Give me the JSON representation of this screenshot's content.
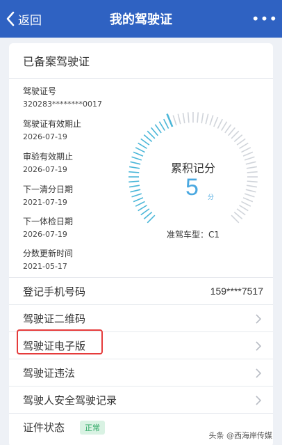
{
  "header": {
    "back_label": "返回",
    "title": "我的驾驶证",
    "more_label": "•••"
  },
  "card": {
    "title": "已备案驾驶证",
    "info": [
      {
        "label": "驾驶证号",
        "value": "320283********0017"
      },
      {
        "label": "驾驶证有效期止",
        "value": "2026-07-19"
      },
      {
        "label": "审验有效期止",
        "value": "2026-07-19"
      },
      {
        "label": "下一清分日期",
        "value": "2021-07-19"
      },
      {
        "label": "下一体检日期",
        "value": "2026-07-19"
      },
      {
        "label": "分数更新时间",
        "value": "2021-05-17"
      }
    ],
    "gauge": {
      "label": "累积记分",
      "value": "5",
      "unit": "分",
      "points": 5,
      "max_points": 12,
      "vehicle_type": "准驾车型：C1",
      "active_color": "#4ab6d8",
      "inactive_color": "#d0d4da"
    },
    "rows": [
      {
        "label": "登记手机号码",
        "value": "159****7517"
      },
      {
        "label": "驾驶证二维码"
      },
      {
        "label": "驾驶证电子版"
      },
      {
        "label": "驾驶证违法"
      },
      {
        "label": "驾驶人安全驾驶记录"
      },
      {
        "label": "证件状态",
        "badge": "正常"
      }
    ]
  },
  "watermark": "头条 @西海岸传媒",
  "colors": {
    "header_bg": "#2f62c2",
    "highlight_border": "#e53b3b",
    "badge_bg": "#d9f2e3",
    "badge_text": "#2ea864"
  }
}
